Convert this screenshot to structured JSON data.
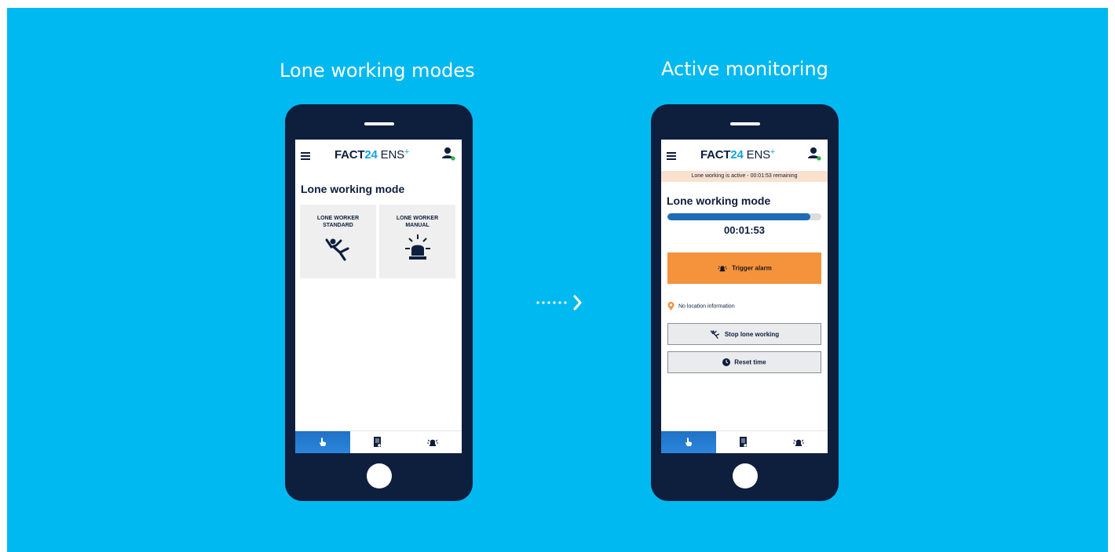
{
  "headings": {
    "left": "Lone working modes",
    "right": "Active monitoring"
  },
  "app": {
    "brand_main": "FACT",
    "brand_number": "24",
    "brand_suffix": " ENS",
    "brand_plus": "+"
  },
  "left_screen": {
    "section_title": "Lone working mode",
    "tiles": [
      {
        "label": "LONE WORKER\nSTANDARD",
        "icon": "falling-person-icon"
      },
      {
        "label": "LONE WORKER\nMANUAL",
        "icon": "alarm-beacon-icon"
      }
    ],
    "nav": [
      {
        "icon": "touch-hand-icon",
        "active": true
      },
      {
        "icon": "document-icon",
        "active": false
      },
      {
        "icon": "alarm-bell-icon",
        "active": false
      }
    ]
  },
  "right_screen": {
    "banner": "Lone working is active - 00:01:53 remaining",
    "section_title": "Lone working mode",
    "progress_fraction": 0.93,
    "timer": "00:01:53",
    "trigger_alarm_label": "Trigger alarm",
    "location_text": "No location information",
    "stop_label": "Stop lone working",
    "reset_label": "Reset time",
    "nav": [
      {
        "icon": "touch-hand-icon",
        "active": true
      },
      {
        "icon": "document-icon",
        "active": false
      },
      {
        "icon": "alarm-bell-icon",
        "active": false
      }
    ]
  },
  "colors": {
    "background": "#00b9f1",
    "phone_body": "#0e1e3d",
    "accent_blue": "#13a3e0",
    "alarm_orange": "#f5933d",
    "banner_bg": "#f8e2cf",
    "progress_fill": "#1f6bb5",
    "active_tab": "#1f72c6"
  }
}
